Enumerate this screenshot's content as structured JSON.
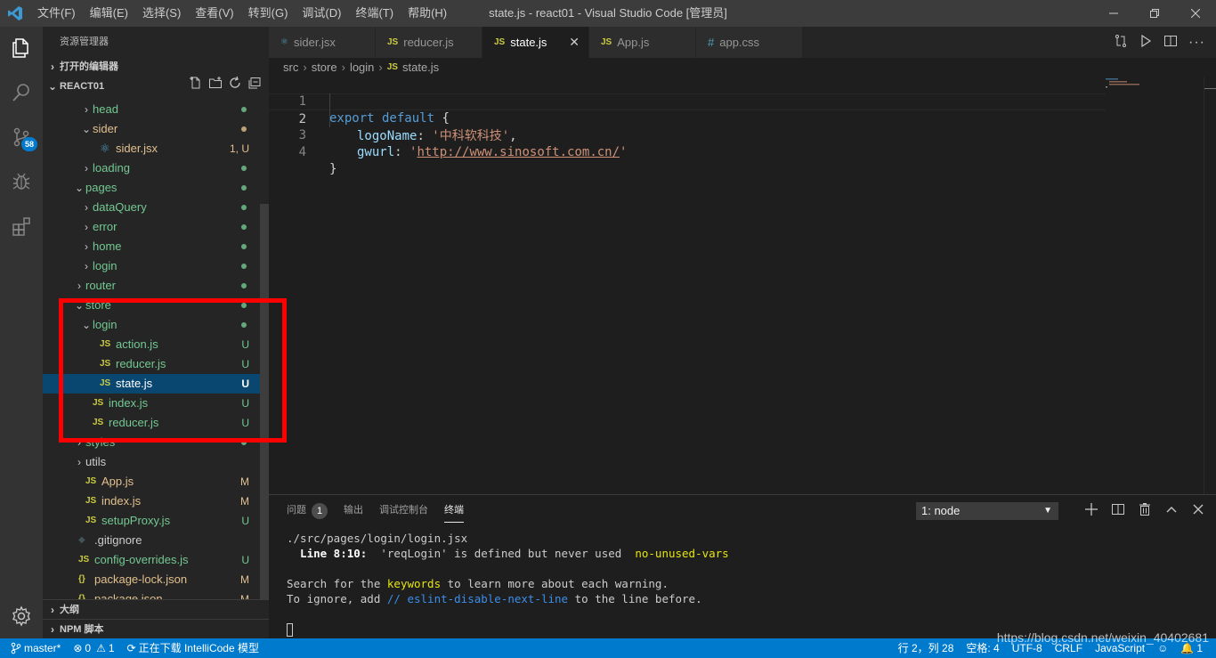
{
  "titlebar": {
    "menu": [
      "文件(F)",
      "编辑(E)",
      "选择(S)",
      "查看(V)",
      "转到(G)",
      "调试(D)",
      "终端(T)",
      "帮助(H)"
    ],
    "title": "state.js - react01 - Visual Studio Code [管理员]"
  },
  "activitybar": {
    "scm_badge": "58"
  },
  "sidebar": {
    "title": "资源管理器",
    "open_editors": "打开的编辑器",
    "root": "REACT01",
    "outline": "大纲",
    "npm_scripts": "NPM 脚本",
    "tree": [
      {
        "indent": 2,
        "twisty": "›",
        "icon": "",
        "name": "head",
        "status": "dot",
        "color": "#73c991"
      },
      {
        "indent": 2,
        "twisty": "⌄",
        "icon": "",
        "name": "sider",
        "status": "dot",
        "color": "#e2c08d",
        "nameColor": "#e2c08d"
      },
      {
        "indent": 3,
        "twisty": "",
        "icon": "react",
        "name": "sider.jsx",
        "status": "1, U",
        "color": "#e2c08d",
        "nameColor": "#e2c08d"
      },
      {
        "indent": 2,
        "twisty": "›",
        "icon": "",
        "name": "loading",
        "status": "dot",
        "color": "#73c991"
      },
      {
        "indent": 1,
        "twisty": "⌄",
        "icon": "",
        "name": "pages",
        "status": "dot",
        "color": "#73c991"
      },
      {
        "indent": 2,
        "twisty": "›",
        "icon": "",
        "name": "dataQuery",
        "status": "dot",
        "color": "#73c991"
      },
      {
        "indent": 2,
        "twisty": "›",
        "icon": "",
        "name": "error",
        "status": "dot",
        "color": "#73c991"
      },
      {
        "indent": 2,
        "twisty": "›",
        "icon": "",
        "name": "home",
        "status": "dot",
        "color": "#73c991"
      },
      {
        "indent": 2,
        "twisty": "›",
        "icon": "",
        "name": "login",
        "status": "dot",
        "color": "#73c991"
      },
      {
        "indent": 1,
        "twisty": "›",
        "icon": "",
        "name": "router",
        "status": "dot",
        "color": "#73c991"
      },
      {
        "indent": 1,
        "twisty": "⌄",
        "icon": "",
        "name": "store",
        "status": "dot",
        "color": "#73c991"
      },
      {
        "indent": 2,
        "twisty": "⌄",
        "icon": "",
        "name": "login",
        "status": "dot",
        "color": "#73c991"
      },
      {
        "indent": 3,
        "twisty": "",
        "icon": "JS",
        "name": "action.js",
        "status": "U",
        "color": "#73c991"
      },
      {
        "indent": 3,
        "twisty": "",
        "icon": "JS",
        "name": "reducer.js",
        "status": "U",
        "color": "#73c991"
      },
      {
        "indent": 3,
        "twisty": "",
        "icon": "JS",
        "name": "state.js",
        "status": "U",
        "color": "#ffffff",
        "selected": true,
        "nameColor": "#ffffff"
      },
      {
        "indent": 2,
        "twisty": "",
        "icon": "JS",
        "name": "index.js",
        "status": "U",
        "color": "#73c991"
      },
      {
        "indent": 2,
        "twisty": "",
        "icon": "JS",
        "name": "reducer.js",
        "status": "U",
        "color": "#73c991"
      },
      {
        "indent": 1,
        "twisty": "›",
        "icon": "",
        "name": "styles",
        "status": "dot",
        "color": "#73c991"
      },
      {
        "indent": 1,
        "twisty": "›",
        "icon": "",
        "name": "utils",
        "status": "",
        "color": "#73c991",
        "nameColor": "#cccccc"
      },
      {
        "indent": 1,
        "twisty": "",
        "icon": "JS",
        "name": "App.js",
        "status": "M",
        "color": "#e2c08d",
        "nameColor": "#e2c08d"
      },
      {
        "indent": 1,
        "twisty": "",
        "icon": "JS",
        "name": "index.js",
        "status": "M",
        "color": "#e2c08d",
        "nameColor": "#e2c08d"
      },
      {
        "indent": 1,
        "twisty": "",
        "icon": "JS",
        "name": "setupProxy.js",
        "status": "U",
        "color": "#73c991"
      },
      {
        "indent": 0,
        "twisty": "",
        "icon": "git",
        "name": ".gitignore",
        "status": "",
        "color": "#cccccc",
        "nameColor": "#cccccc"
      },
      {
        "indent": 0,
        "twisty": "",
        "icon": "JS",
        "name": "config-overrides.js",
        "status": "U",
        "color": "#73c991"
      },
      {
        "indent": 0,
        "twisty": "",
        "icon": "{}",
        "name": "package-lock.json",
        "status": "M",
        "color": "#e2c08d",
        "nameColor": "#e2c08d"
      },
      {
        "indent": 0,
        "twisty": "",
        "icon": "{}",
        "name": "package.json",
        "status": "M",
        "color": "#e2c08d",
        "nameColor": "#e2c08d"
      }
    ]
  },
  "tabs": [
    {
      "icon": "react",
      "label": "sider.jsx",
      "active": false
    },
    {
      "icon": "JS",
      "label": "reducer.js",
      "active": false
    },
    {
      "icon": "JS",
      "label": "state.js",
      "active": true
    },
    {
      "icon": "JS",
      "label": "App.js",
      "active": false
    },
    {
      "icon": "#",
      "label": "app.css",
      "active": false
    }
  ],
  "breadcrumb": [
    "src",
    "store",
    "login",
    "state.js"
  ],
  "code": {
    "line1": {
      "num": "1",
      "kw": "export default",
      "rest": " {"
    },
    "line2": {
      "num": "2",
      "prop": "logoName",
      "colon": ": ",
      "str": "'中科软科技'",
      "tail": ","
    },
    "line3": {
      "num": "3",
      "prop": "gwurl",
      "colon": ": ",
      "q1": "'",
      "url": "http://www.sinosoft.com.cn/",
      "q2": "'"
    },
    "line4": {
      "num": "4",
      "text": "}"
    }
  },
  "panel": {
    "tabs": {
      "problems": "问题",
      "problems_count": "1",
      "output": "输出",
      "debug_console": "调试控制台",
      "terminal": "终端"
    },
    "terminal_select": "1: node",
    "lines": {
      "l1": "./src/pages/login/login.jsx",
      "l2_a": "  Line 8:10:",
      "l2_b": "  'reqLogin' is defined but never used  ",
      "l2_c": "no-unused-vars",
      "l3_a": "Search for the ",
      "l3_b": "keywords",
      "l3_c": " to learn more about each warning.",
      "l4_a": "To ignore, add ",
      "l4_b": "// eslint-disable-next-line",
      "l4_c": " to the line before."
    }
  },
  "statusbar": {
    "branch": "master*",
    "errors": "0",
    "warnings": "1",
    "download": "正在下载 IntelliCode 模型",
    "position": "行 2，列 28",
    "spaces": "空格: 4",
    "encoding": "UTF-8",
    "eol": "CRLF",
    "language": "JavaScript",
    "notifications": "1"
  },
  "watermark": "https://blog.csdn.net/weixin_40402681",
  "colors": {
    "accent": "#007acc",
    "highlight_box": "#ff0000",
    "js_icon": "#cbcb41"
  }
}
